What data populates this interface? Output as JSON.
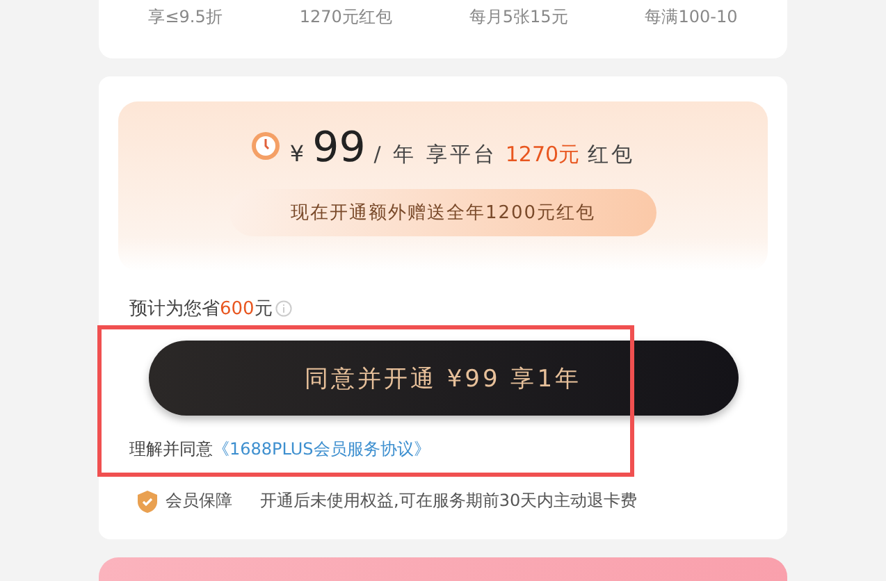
{
  "benefits": [
    "享≤9.5折",
    "1270元红包",
    "每月5张15元",
    "每满100-10"
  ],
  "offer": {
    "currency": "¥",
    "price": "99",
    "per_year": "/ 年 享平台",
    "bonus": "1270元",
    "bonus_suffix": "红包",
    "promo": "现在开通额外赠送全年1200元红包"
  },
  "savings": {
    "prefix": "预计为您省",
    "amount": "600",
    "suffix": "元"
  },
  "cta_button": "同意并开通 ¥99 享1年",
  "agreement": {
    "prefix": "理解并同意",
    "link": "《1688PLUS会员服务协议》"
  },
  "guarantee": {
    "title": "会员保障",
    "text": "开通后未使用权益,可在服务期前30天内主动退卡费"
  }
}
